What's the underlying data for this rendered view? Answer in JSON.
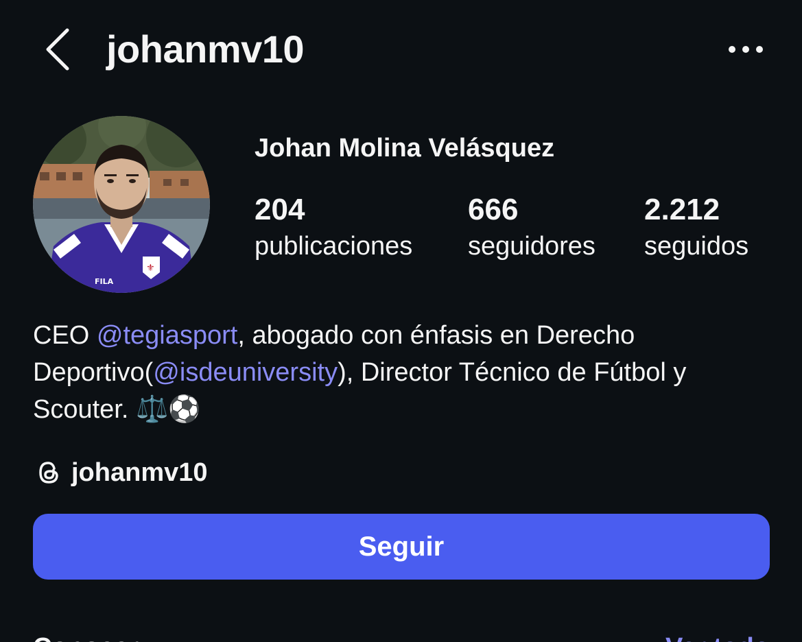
{
  "header": {
    "username": "johanmv10",
    "back_icon": "chevron-left-icon",
    "more_icon": "more-horizontal-icon"
  },
  "profile": {
    "display_name": "Johan Molina Velásquez",
    "avatar_icon": "avatar",
    "stats": [
      {
        "value": "204",
        "label": "publicaciones"
      },
      {
        "value": "666",
        "label": "seguidores"
      },
      {
        "value": "2.212",
        "label": "seguidos"
      }
    ]
  },
  "bio": {
    "part1": "CEO ",
    "mention1": "@tegiasport",
    "part2": ", abogado con énfasis en Derecho Deportivo(",
    "mention2": "@isdeuniversity",
    "part3": "), Director Técnico de Fútbol y Scouter. ",
    "emojis": "⚖️⚽️"
  },
  "threads": {
    "icon": "threads-icon",
    "handle": "johanmv10"
  },
  "actions": {
    "follow_label": "Seguir"
  },
  "bottom_row": {
    "left_text": "Conocer",
    "right_text": "Ver todo"
  },
  "colors": {
    "background": "#0c1014",
    "primary_button": "#4a5df0",
    "mention": "#8a8cf5",
    "text": "#f5f5f5"
  }
}
